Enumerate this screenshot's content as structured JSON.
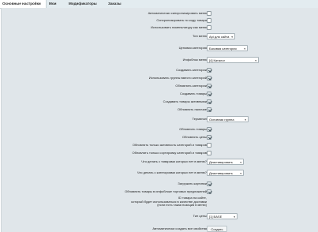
{
  "tabs": [
    {
      "label": "Основные настройки"
    },
    {
      "label": "Мои"
    },
    {
      "label": "Модификаторы"
    },
    {
      "label": "Заказы"
    }
  ],
  "settings": {
    "auto_sync": "Автоматически синхронизировать меню",
    "sync_by_code": "Синхронизировать по коду товара",
    "use_nomenclature": "Использовать номенклатуру как меню",
    "menu_type_label": "Тип меню",
    "menu_type_value": "Api для сайта",
    "price_category_label": "Ценовая категория",
    "price_category_value": "Базовая категория",
    "iblock_menu_label": "Инфоблок меню",
    "iblock_menu_value": "[4] Каталог",
    "create_categories": "Создавать категории",
    "use_group_instead": "Использовать группы вместо категорий",
    "update_categories": "Обновлять категории",
    "create_products": "Создавать товары",
    "create_products_active": "Создавать товары активными",
    "update_stock": "Обновлять наличие",
    "terminal_label": "Терминал",
    "terminal_value": "Основная группа",
    "update_products": "Обновлять товары",
    "update_prices": "Обновлять цены",
    "update_activity_only": "Обновлять только активность категорий и товаров",
    "update_sort_only": "Обновлять только сортировку категорий и товаров",
    "missing_products_label": "Что делать с товарами которых нет в меню?",
    "missing_products_value": "Деактивировать",
    "missing_categories_label": "Что делать с категориями которых нет в меню?",
    "missing_categories_value": "Деактивировать",
    "load_images": "Загружать картинки",
    "update_offers": "Обновлять товары в инфоблоке торговых предложений",
    "delivery_id_line1": "ID товара на сайте,",
    "delivery_id_line2": "который будет использоваться в качестве доставки",
    "delivery_id_line3": "(если есть такая позиция в меню)",
    "price_type_label": "Тип цены",
    "price_type_value": "[1] BASE",
    "auto_create_props_label": "Автоматически создать все свойства",
    "create_button": "Создать"
  },
  "state": {
    "auto_sync": false,
    "sync_by_code": false,
    "use_nomenclature": false,
    "create_categories": true,
    "use_group_instead": true,
    "update_categories": true,
    "create_products": true,
    "create_products_active": true,
    "update_stock": true,
    "update_products": true,
    "update_prices": true,
    "update_activity_only": false,
    "update_sort_only": false,
    "load_images": true,
    "update_offers": true
  }
}
